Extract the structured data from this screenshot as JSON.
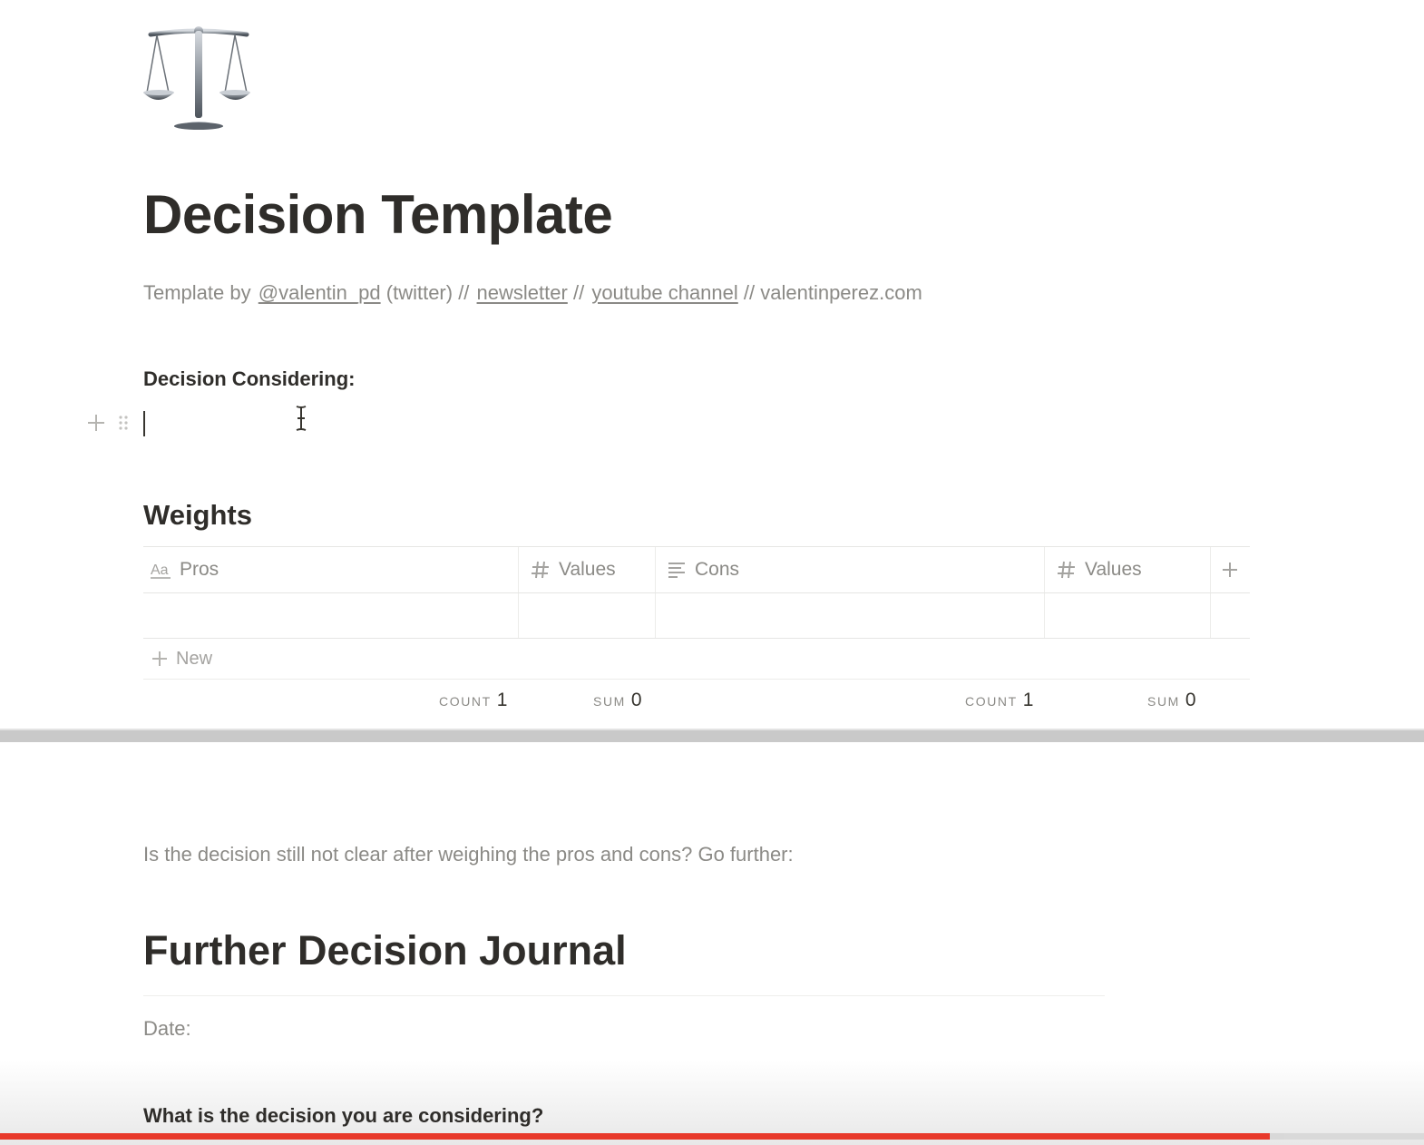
{
  "page": {
    "icon": "balance-scale-icon",
    "title": "Decision Template",
    "byline": {
      "prefix": "Template by",
      "twitter_link": "@valentin_pd",
      "twitter_suffix": "(twitter) //",
      "newsletter_link": "newsletter",
      "sep": "//",
      "youtube_link": "youtube channel",
      "website": "// valentinperez.com"
    },
    "decision_label": "Decision Considering:",
    "decision_value": ""
  },
  "weights": {
    "heading": "Weights",
    "columns": [
      {
        "label": "Pros",
        "icon": "title-aa-icon"
      },
      {
        "label": "Values",
        "icon": "number-hash-icon"
      },
      {
        "label": "Cons",
        "icon": "text-lines-icon"
      },
      {
        "label": "Values",
        "icon": "number-hash-icon"
      }
    ],
    "rows": [
      {
        "pros": "",
        "pros_value": "",
        "cons": "",
        "cons_value": ""
      }
    ],
    "new_label": "New",
    "calculations": [
      {
        "key": "COUNT",
        "value": "1"
      },
      {
        "key": "SUM",
        "value": "0"
      },
      {
        "key": "COUNT",
        "value": "1"
      },
      {
        "key": "SUM",
        "value": "0"
      }
    ]
  },
  "further": {
    "prompt": "Is the decision still not clear after weighing the pros and cons? Go further:",
    "heading": "Further Decision Journal",
    "date_label": "Date:",
    "question": "What is the decision you are considering?"
  },
  "video": {
    "progress": 0.892,
    "buffered": 0.902,
    "progress_color": "#e8392b"
  },
  "colors": {
    "text": "#37352f",
    "muted": "#8b8a86",
    "border": "#e6e6e4"
  }
}
